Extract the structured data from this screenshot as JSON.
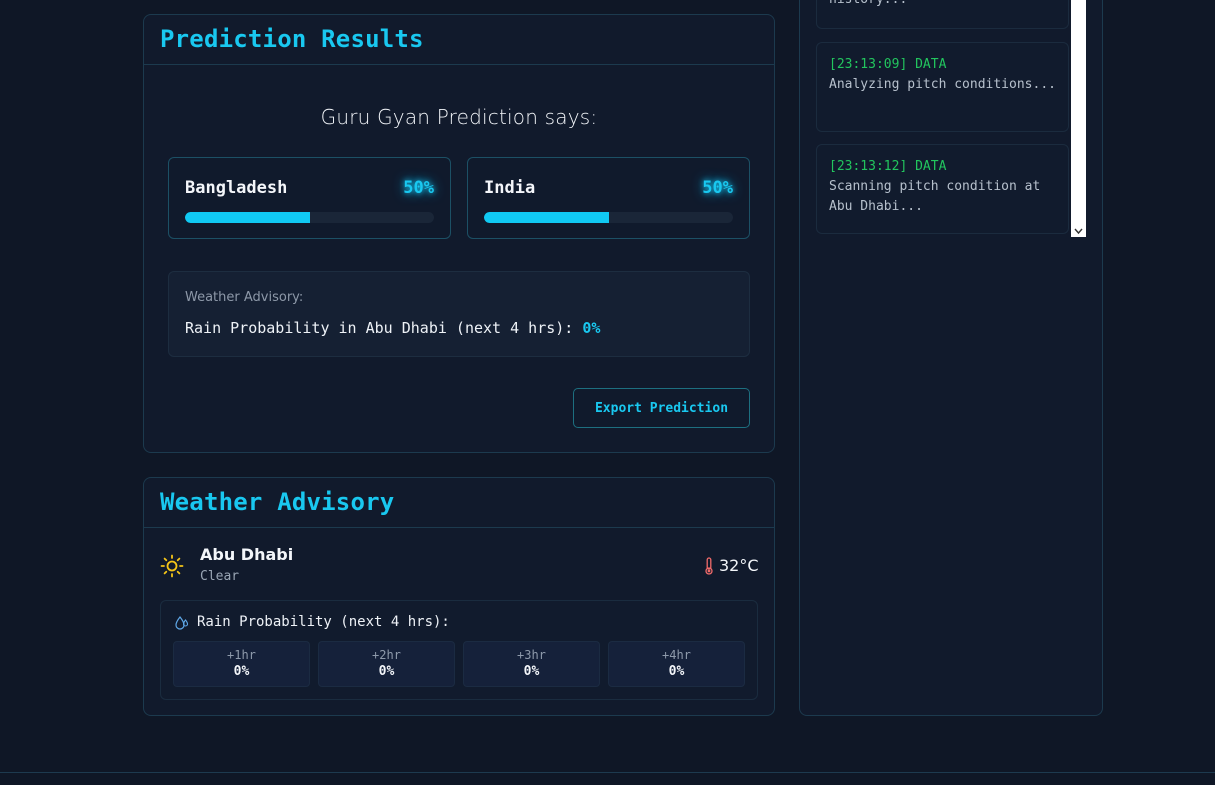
{
  "prediction": {
    "title": "Prediction Results",
    "headline": "Guru Gyan Prediction says:",
    "teams": [
      {
        "name": "Bangladesh",
        "percent_label": "50%",
        "percent": 50
      },
      {
        "name": "India",
        "percent_label": "50%",
        "percent": 50
      }
    ],
    "advisory": {
      "label": "Weather Advisory:",
      "text": "Rain Probability in Abu Dhabi (next 4 hrs):",
      "value": "0%"
    },
    "export_label": "Export Prediction"
  },
  "weather": {
    "title": "Weather Advisory",
    "city": "Abu Dhabi",
    "condition": "Clear",
    "temperature": "32°C",
    "condition_icon": "sun-icon",
    "temp_icon": "thermometer-icon",
    "rain_icon": "droplet-icon",
    "rain_title": "Rain Probability (next 4 hrs):",
    "hours": [
      {
        "label": "+1hr",
        "value": "0%"
      },
      {
        "label": "+2hr",
        "value": "0%"
      },
      {
        "label": "+3hr",
        "value": "0%"
      },
      {
        "label": "+4hr",
        "value": "0%"
      }
    ]
  },
  "log": {
    "entries": [
      {
        "time": "",
        "message": "history..."
      },
      {
        "time": "[23:13:09] DATA",
        "message": "Analyzing pitch conditions..."
      },
      {
        "time": "[23:13:12] DATA",
        "message": "Scanning pitch condition at Abu Dhabi..."
      }
    ]
  },
  "colors": {
    "accent": "#19c8f0",
    "log_time": "#22c55e",
    "background": "#0f1726"
  }
}
